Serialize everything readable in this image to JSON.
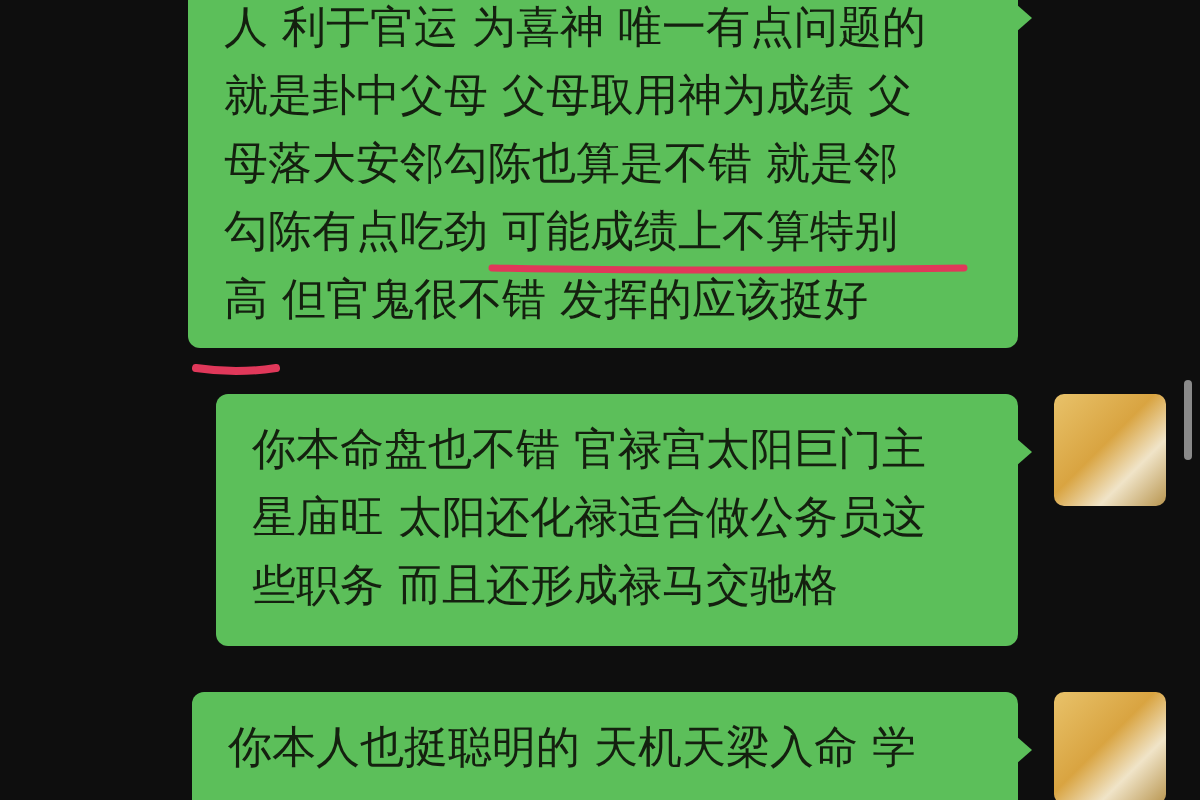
{
  "messages": [
    {
      "lines": [
        "人 利于官运 为喜神 唯一有点问题的",
        "就是卦中父母 父母取用神为成绩 父",
        "母落大安邻勾陈也算是不错 就是邻",
        "勾陈有点吃劲 可能成绩上不算特别",
        "高 但官鬼很不错 发挥的应该挺好"
      ],
      "show_avatar": false
    },
    {
      "lines": [
        "你本命盘也不错 官禄宫太阳巨门主",
        "星庙旺 太阳还化禄适合做公务员这",
        "些职务 而且还形成禄马交驰格"
      ],
      "show_avatar": true
    },
    {
      "lines": [
        "你本人也挺聪明的 天机天梁入命 学"
      ],
      "show_avatar": true
    }
  ]
}
